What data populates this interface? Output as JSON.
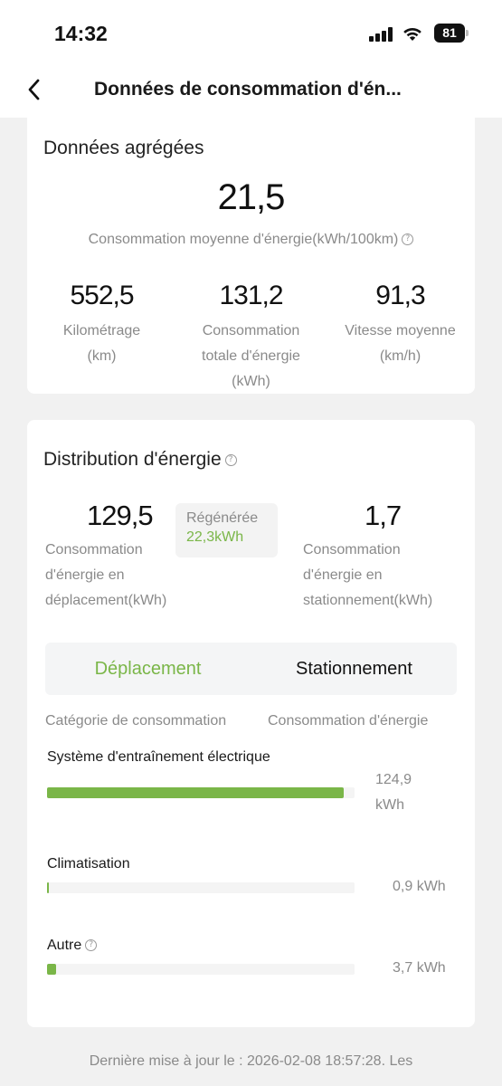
{
  "status": {
    "time": "14:32",
    "battery": "81"
  },
  "nav": {
    "title": "Données de consommation d'én..."
  },
  "aggregated": {
    "title": "Données agrégées",
    "average_value": "21,5",
    "average_label": "Consommation moyenne d'énergie(kWh/100km)",
    "stats": [
      {
        "value": "552,5",
        "label_lines": [
          "Kilométrage",
          "(km)"
        ]
      },
      {
        "value": "131,2",
        "label_lines": [
          "Consommation",
          "totale d'énergie",
          "(kWh)"
        ]
      },
      {
        "value": "91,3",
        "label_lines": [
          "Vitesse moyenne",
          "(km/h)"
        ]
      }
    ]
  },
  "distribution": {
    "title": "Distribution d'énergie",
    "driving_value": "129,5",
    "driving_label_lines": [
      "Consommation",
      "d'énergie en",
      "déplacement(kWh)"
    ],
    "regen_label": "Régénérée",
    "regen_value": "22,3kWh",
    "parking_value": "1,7",
    "parking_label_lines": [
      "Consommation",
      "d'énergie en",
      "stationnement(kWh)"
    ],
    "tabs": [
      {
        "label": "Déplacement",
        "active": true
      },
      {
        "label": "Stationnement",
        "active": false
      }
    ],
    "col_category": "Catégorie de consommation",
    "col_energy": "Consommation d'énergie",
    "categories": [
      {
        "name": "Système d'entraînement électrique",
        "value_lines": [
          "124,9",
          "kWh"
        ],
        "fill": 0.965
      },
      {
        "name": "Climatisation",
        "value": "0,9 kWh",
        "fill": 0.007
      },
      {
        "name": "Autre",
        "value": "3,7 kWh",
        "fill": 0.029,
        "help": true
      }
    ]
  },
  "footer": {
    "text": "Dernière mise à jour le : 2026-02-08 18:57:28. Les"
  },
  "colors": {
    "accent": "#7ab648",
    "muted": "#8a8a8a",
    "background": "#f1f1f1"
  }
}
